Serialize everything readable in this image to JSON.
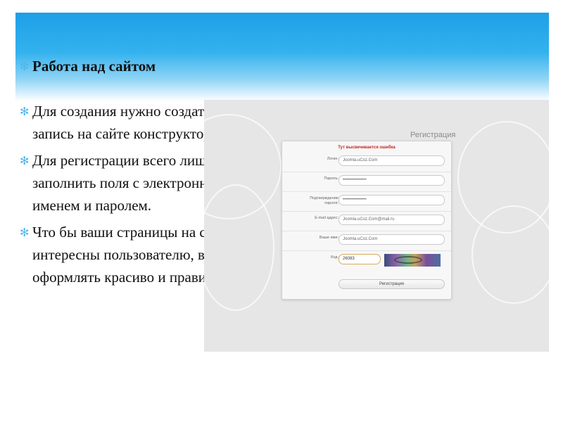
{
  "slide": {
    "title": "Работа над сайтом",
    "bullets": [
      "Для создания  нужно создать учётную запись на сайте конструктора.",
      "Для регистрации всего лишь надо заполнить поля с электронной почтой, именем и паролем.",
      "Что бы ваши страницы на сайте были интересны пользователю, вам надо их оформлять красиво и правильно."
    ],
    "bullet_symbol": "✻",
    "accent_color": "#2aa8ec"
  },
  "screenshot": {
    "heading": "Регистрация",
    "error_text": "Тут высвечивается ошибка",
    "fields": [
      {
        "label": "Логин:",
        "value": "Joomla.uCoz.Com"
      },
      {
        "label": "Пароль:",
        "value": "••••••••••••••••"
      },
      {
        "label": "Подтверждение пароля:",
        "value": "••••••••••••••••"
      },
      {
        "label": "E-mail адрес:",
        "value": "Joomla.uCoz.Com@mail.ru"
      },
      {
        "label": "Ваше имя:",
        "value": "Joomla.uCoz.Com"
      },
      {
        "label": "Код:",
        "value": "26083"
      }
    ],
    "submit_label": "Регистрация"
  }
}
